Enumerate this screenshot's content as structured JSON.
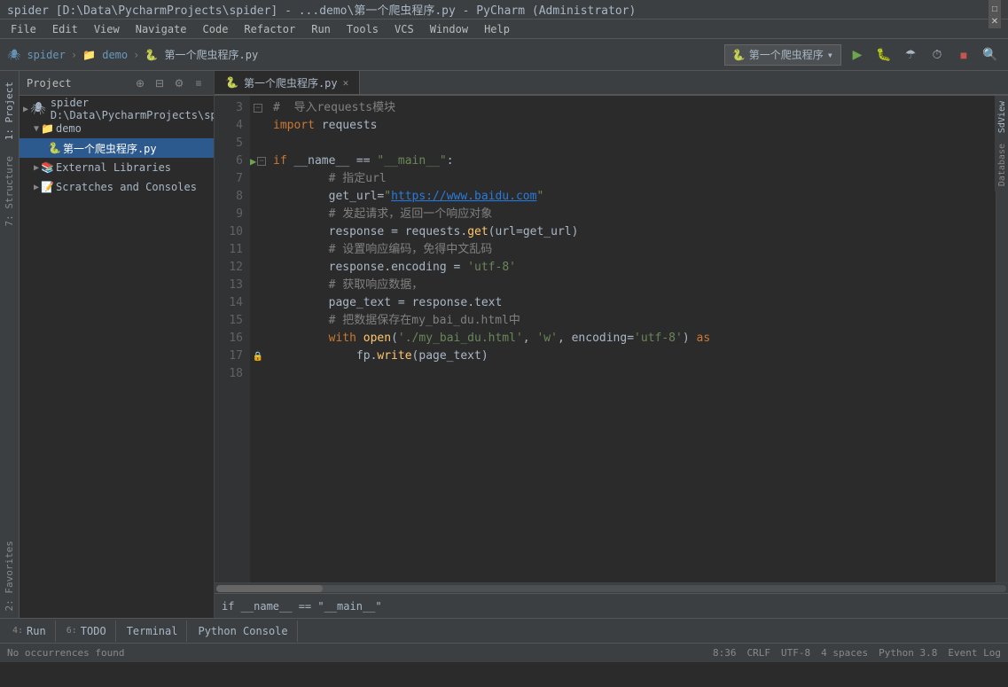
{
  "titleBar": {
    "text": "spider [D:\\Data\\PycharmProjects\\spider] - ...demo\\第一个爬虫程序.py - PyCharm (Administrator)",
    "minimizeLabel": "─",
    "maximizeLabel": "□",
    "closeLabel": "✕"
  },
  "menuBar": {
    "items": [
      "File",
      "Edit",
      "View",
      "Navigate",
      "Code",
      "Refactor",
      "Run",
      "Tools",
      "VCS",
      "Window",
      "Help"
    ]
  },
  "toolbar": {
    "breadcrumbs": [
      "spider",
      "demo",
      "第一个爬虫程序.py"
    ],
    "runConfig": "第一个爬虫程序",
    "searchIcon": "🔍"
  },
  "projectPanel": {
    "title": "Project",
    "expandIcon": "+",
    "settingsIcon": "⚙",
    "gearIcon": "≡",
    "items": [
      {
        "level": 0,
        "label": "spider D:\\Data\\PycharmProjects\\spider",
        "type": "root",
        "icon": "▶"
      },
      {
        "level": 1,
        "label": "demo",
        "type": "folder",
        "icon": "▼",
        "expanded": true
      },
      {
        "level": 2,
        "label": "第一个爬虫程序.py",
        "type": "file",
        "selected": true
      },
      {
        "level": 1,
        "label": "External Libraries",
        "type": "folder",
        "icon": "▶"
      },
      {
        "level": 1,
        "label": "Scratches and Consoles",
        "type": "folder",
        "icon": "▶"
      }
    ]
  },
  "editorTabs": [
    {
      "label": "第一个爬虫程序.py",
      "active": true,
      "modified": false
    }
  ],
  "codeLines": [
    {
      "num": 3,
      "content": "comment",
      "text": "#  导入requests模块",
      "hasBreakpoint": false,
      "hasFold": true
    },
    {
      "num": 4,
      "content": "import",
      "text": "import requests",
      "hasBreakpoint": false
    },
    {
      "num": 5,
      "content": "blank",
      "text": "",
      "hasBreakpoint": false
    },
    {
      "num": 6,
      "content": "if_main",
      "text": "if __name__ == \"__main__\":",
      "hasBreakpoint": false,
      "hasRun": true,
      "hasFold": true
    },
    {
      "num": 7,
      "content": "comment",
      "text": "    # 指定url",
      "hasBreakpoint": false
    },
    {
      "num": 8,
      "content": "get_url",
      "text": "    get_url=\"https://www.baidu.com\"",
      "hasBreakpoint": false
    },
    {
      "num": 9,
      "content": "comment",
      "text": "    # 发起请求，返回一个响应对象",
      "hasBreakpoint": false
    },
    {
      "num": 10,
      "content": "response",
      "text": "    response = requests.get(url=get_url)",
      "hasBreakpoint": false
    },
    {
      "num": 11,
      "content": "comment",
      "text": "    # 设置响应编码，免得中文乱码",
      "hasBreakpoint": false
    },
    {
      "num": 12,
      "content": "encoding",
      "text": "    response.encoding = 'utf-8'",
      "hasBreakpoint": false
    },
    {
      "num": 13,
      "content": "comment",
      "text": "    # 获取响应数据，",
      "hasBreakpoint": false
    },
    {
      "num": 14,
      "content": "page_text",
      "text": "    page_text = response.text",
      "hasBreakpoint": false
    },
    {
      "num": 15,
      "content": "comment",
      "text": "    # 把数据保存在my_bai_du.html中",
      "hasBreakpoint": false
    },
    {
      "num": 16,
      "content": "with_open",
      "text": "    with open('./my_bai_du.html', 'w', encoding='utf-8') as",
      "hasBreakpoint": false
    },
    {
      "num": 17,
      "content": "fp_write",
      "text": "        fp.write(page_text)",
      "hasBreakpoint": false,
      "hasLock": true
    },
    {
      "num": 18,
      "content": "blank",
      "text": "",
      "hasBreakpoint": false
    }
  ],
  "bottomPanel": {
    "findBarText": "if __name__ == \"__main__\"",
    "noOccurrences": "No occurrences found"
  },
  "statusBar": {
    "position": "8:36",
    "lineEnding": "CRLF",
    "encoding": "UTF-8",
    "indent": "4 spaces",
    "pythonVersion": "Python 3.8",
    "eventLog": "Event Log"
  },
  "bottomTabs": [
    {
      "num": "4",
      "label": "Run"
    },
    {
      "num": "6",
      "label": "TODO"
    },
    {
      "label": "Terminal"
    },
    {
      "label": "Python Console"
    }
  ],
  "rightPanels": [
    {
      "label": "SdView"
    },
    {
      "label": "Database"
    }
  ],
  "leftStripLabels": [
    {
      "label": "1: Project",
      "active": true
    },
    {
      "label": "2: Favorites"
    },
    {
      "label": "7: Structure"
    }
  ],
  "colors": {
    "keyword": "#cc7832",
    "string": "#6a8759",
    "comment": "#808080",
    "function": "#ffc66d",
    "url": "#287bde",
    "normal": "#a9b7c6",
    "background": "#2b2b2b",
    "lineHighlight": "#344134",
    "selected": "#2d5a8e",
    "runGreen": "#6ea64f"
  }
}
